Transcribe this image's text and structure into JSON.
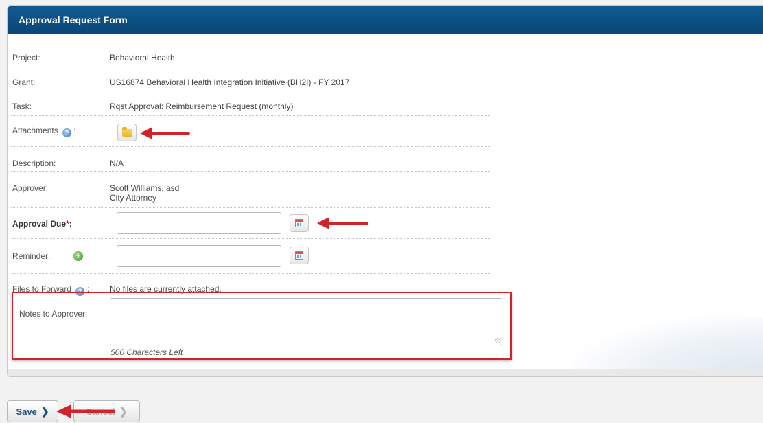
{
  "form": {
    "title": "Approval Request Form",
    "project_label": "Project:",
    "project_value": "Behavioral Health",
    "grant_label": "Grant:",
    "grant_value": "US16874 Behavioral Health Integration Initiative (BH2I) - FY 2017",
    "task_label": "Task:",
    "task_value": "Rqst Approval: Reimbursement Request (monthly)",
    "attachments_label": "Attachments",
    "colon": ":",
    "description_label": "Description:",
    "description_value": "N/A",
    "approver_label": "Approver:",
    "approver_name": "Scott Williams, asd",
    "approver_title": "City Attorney",
    "approval_due_label": "Approval Due",
    "required_mark": "*",
    "approval_due_value": "",
    "reminder_label": "Reminder:",
    "reminder_value": "",
    "files_forward_label": "Files to Forward",
    "files_forward_value": "No files are currently attached.",
    "notes_label": "Notes to Approver:",
    "notes_value": "",
    "chars_left": "500 Characters Left"
  },
  "buttons": {
    "save": "Save",
    "cancel": "Cancel",
    "chevron": "❯"
  },
  "icons": {
    "help": "?",
    "add": "+"
  },
  "colors": {
    "header_bg": "#0b4f84",
    "annotation_red": "#d3232a",
    "required_red": "#cc0000"
  }
}
